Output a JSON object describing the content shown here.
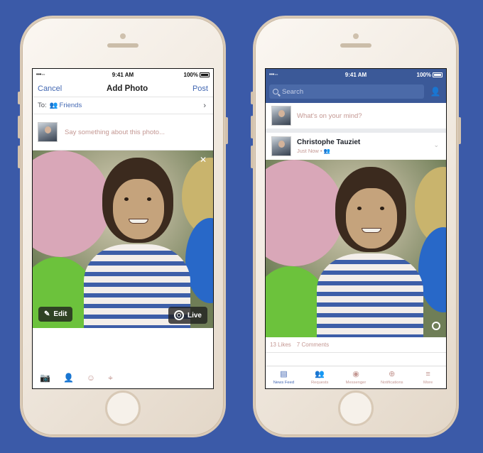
{
  "colors": {
    "background": "#3b5aa8",
    "facebook_blue": "#3b5998",
    "link_blue": "#4267b2",
    "placeholder_pink": "#c49893"
  },
  "status_bar": {
    "signal": "•••◦◦",
    "time": "9:41 AM",
    "battery": "100%"
  },
  "add_photo": {
    "cancel_label": "Cancel",
    "title": "Add Photo",
    "post_label": "Post",
    "to_label": "To:",
    "audience_label": "Friends",
    "compose_placeholder": "Say something about this photo...",
    "edit_label": "Edit",
    "live_label": "Live",
    "toolbar_icons": [
      "camera-icon",
      "tag-people-icon",
      "feeling-icon",
      "location-icon"
    ]
  },
  "news_feed": {
    "search_placeholder": "Search",
    "status_placeholder": "What's on your mind?",
    "post": {
      "author": "Christophe Tauziet",
      "time": "Just Now",
      "likes": "13 Likes",
      "comments": "7 Comments"
    },
    "tabs": [
      {
        "label": "News Feed",
        "icon": "news-feed-icon",
        "active": true
      },
      {
        "label": "Requests",
        "icon": "requests-icon",
        "active": false
      },
      {
        "label": "Messenger",
        "icon": "messenger-icon",
        "active": false
      },
      {
        "label": "Notifications",
        "icon": "notifications-icon",
        "active": false
      },
      {
        "label": "More",
        "icon": "more-icon",
        "active": false
      }
    ]
  }
}
